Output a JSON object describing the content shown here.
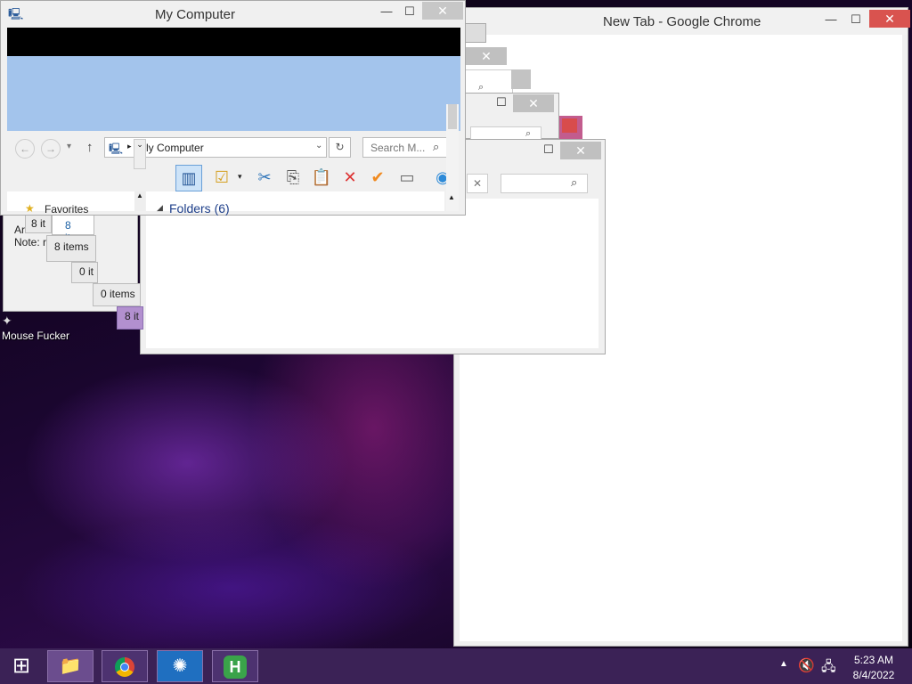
{
  "desktop": {
    "icon_label": "Mouse Fucker"
  },
  "chrome": {
    "title": "New Tab - Google Chrome"
  },
  "explorer": {
    "title": "My Computer",
    "address": "ly Computer",
    "search_placeholder": "Search M...",
    "nav_favorites": "Favorites",
    "section_header": "Folders (6)"
  },
  "background_windows": {
    "status_a": "8 it",
    "status_b": "8 item",
    "status_c": "8 items",
    "status_d": "0 it",
    "status_e": "0 items",
    "status_f": "8 it",
    "text_line1": "Ar",
    "text_line2": "Note: r"
  },
  "taskbar": {
    "time": "5:23 AM",
    "date": "8/4/2022"
  },
  "colors": {
    "taskbar_bg": "#3b2256",
    "accent_blue": "#a3c4ec",
    "close_red": "#d9534f"
  }
}
